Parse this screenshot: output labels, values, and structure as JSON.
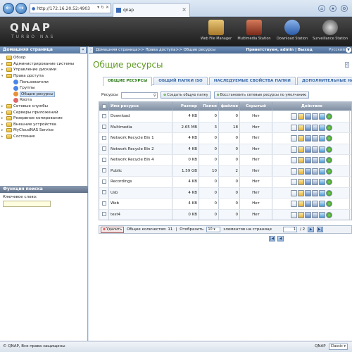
{
  "browser": {
    "url": "http://172.16.20.52:4903",
    "tab_title": "qnap"
  },
  "header": {
    "logo": "QNAP",
    "logo_sub": "TURBO NAS",
    "apps": [
      {
        "label": "Web File Manager",
        "color": "#c89a3c"
      },
      {
        "label": "Multimedia Station",
        "color": "#a83a2a"
      },
      {
        "label": "Download Station",
        "color": "#3a6ab8"
      },
      {
        "label": "Surveillance Station",
        "color": "#777777"
      }
    ]
  },
  "sidebar": {
    "title": "Домашняя страница",
    "items": [
      {
        "label": "Обзор",
        "indent": 0
      },
      {
        "label": "Администрирование системы",
        "indent": 0
      },
      {
        "label": "Управление дисками",
        "indent": 0
      },
      {
        "label": "Права доступа",
        "indent": 0
      },
      {
        "label": "Пользователи",
        "indent": 1
      },
      {
        "label": "Группы",
        "indent": 1
      },
      {
        "label": "Общие ресурсы",
        "indent": 1
      },
      {
        "label": "Квота",
        "indent": 1
      },
      {
        "label": "Сетевые службы",
        "indent": 0
      },
      {
        "label": "Серверы приложений",
        "indent": 0
      },
      {
        "label": "Резервное копирование",
        "indent": 0
      },
      {
        "label": "Внешние устройства",
        "indent": 0
      },
      {
        "label": "MyCloudNAS Service",
        "indent": 0
      },
      {
        "label": "Состояние",
        "indent": 0
      }
    ],
    "search_panel": {
      "title": "Функция поиска",
      "keyword_label": "Ключевое слово:"
    }
  },
  "topbar": {
    "breadcrumb": "Домашняя страница>> Права доступа>> Общие ресурсы",
    "greeting": "Приветствуем, admin | Выход",
    "language": "Русский"
  },
  "main": {
    "title": "Общие ресурсы",
    "tabs": [
      "ОБЩИЕ РЕСУРСЫ",
      "ОБЩИЙ ПАПКИ ISO",
      "НАСЛЕДУЕМЫЕ СВОЙСТВА ПАПКИ",
      "ДОПОЛНИТЕЛЬНЫЕ НАСТ"
    ],
    "search_label": "Ресурсы",
    "create_btn": "Создать общую папку",
    "restore_btn": "Восстановить сетевые ресурсы по умолчанию",
    "columns": [
      "Имя ресурса",
      "Размер",
      "Папки",
      "файлов",
      "Скрытый",
      "Действие"
    ],
    "rows": [
      {
        "name": "Download",
        "size": "4 KB",
        "folders": "0",
        "files": "0",
        "hidden": "Нет"
      },
      {
        "name": "Multimedia",
        "size": "2.65 MB",
        "folders": "3",
        "files": "18",
        "hidden": "Нет"
      },
      {
        "name": "Network Recycle Bin 1",
        "size": "4 KB",
        "folders": "0",
        "files": "0",
        "hidden": "Нет"
      },
      {
        "name": "Network Recycle Bin 2",
        "size": "4 KB",
        "folders": "0",
        "files": "0",
        "hidden": "Нет"
      },
      {
        "name": "Network Recycle Bin 4",
        "size": "0 KB",
        "folders": "0",
        "files": "0",
        "hidden": "Нет"
      },
      {
        "name": "Public",
        "size": "1.59 GB",
        "folders": "10",
        "files": "2",
        "hidden": "Нет"
      },
      {
        "name": "Recordings",
        "size": "4 KB",
        "folders": "0",
        "files": "0",
        "hidden": "Нет"
      },
      {
        "name": "Usb",
        "size": "4 KB",
        "folders": "0",
        "files": "0",
        "hidden": "Нет"
      },
      {
        "name": "Web",
        "size": "4 KB",
        "folders": "0",
        "files": "0",
        "hidden": "Нет"
      },
      {
        "name": "test4",
        "size": "0 KB",
        "folders": "0",
        "files": "0",
        "hidden": "Нет"
      }
    ],
    "pager": {
      "delete_label": "Удалить",
      "total": "Общее количество: 11",
      "show_label": "Отобразить",
      "per_page": "10",
      "per_page_suffix": "элементов на странице",
      "page": "1",
      "page_total": "/ 2"
    }
  },
  "footer": {
    "copyright": "© QNAP, Все права защищены",
    "brand": "QNAP",
    "theme": "Classic"
  }
}
